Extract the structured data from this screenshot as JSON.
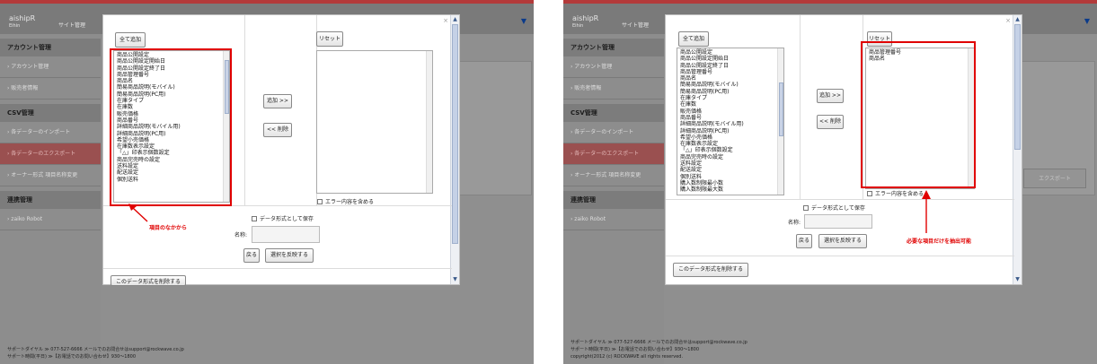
{
  "app": {
    "logo": "aishipR",
    "logo_sub": "Eihin",
    "site_manager": "サイト管理",
    "menu_arrow_icon": "triangle-down-icon"
  },
  "sidebar": {
    "account_section": "アカウント管理",
    "account_mgmt": "› アカウント管理",
    "seller_info": "› 販売者情報",
    "csv_section": "CSV管理",
    "import": "› 各データーのインポート",
    "export": "› 各データーのエクスポート",
    "owner_format": "› オーナー形式 項目名称変更",
    "integration_section": "連携管理",
    "zaiko": "› zaiko Robot"
  },
  "main": {
    "export_button": "エクスポート"
  },
  "footer": {
    "line1": "サポートダイヤル ≫ 077-527-6666 メールでのお問合せはsupport@rockwave.co.jp",
    "line2": "サポート時間(平日) ≫【お電話でのお問い合わせ】930～1800",
    "line3": "copyright(2012 (c) ROCKWAVE all rights reserved."
  },
  "modal": {
    "close_icon": "close-icon",
    "add_all": "全て追加",
    "reset": "リセット",
    "add_button": "追加 >>",
    "remove_button": "<< 削除",
    "error_checkbox": "エラー内容を含める",
    "save_format_checkbox": "データ形式として保存",
    "name_label": "名称:",
    "back_button": "戻る",
    "apply_button": "選択を反映する",
    "delete_format_button": "このデータ形式を削除する",
    "available_items": [
      "商品公開設定",
      "商品公開設定開始日",
      "商品公開設定終了日",
      "商品管理番号",
      "商品名",
      "簡易商品説明(モバイル)",
      "簡易商品説明(PC用)",
      "在庫タイプ",
      "在庫数",
      "販売価格",
      "商品番号",
      "詳細商品説明(モバイル用)",
      "詳細商品説明(PC用)",
      "希望小売価格",
      "在庫数表示設定",
      "「△」印表示個数設定",
      "商品完売時の設定",
      "送料設定",
      "配送設定",
      "個別送料",
      "購入数制限最小数",
      "購入数制限最大数"
    ],
    "selected_items": [
      "商品管理番号",
      "商品名"
    ]
  },
  "annotations": {
    "left": "項目のなかから",
    "right": "必要な項目だけを抽出可能",
    "color": "#e00000"
  },
  "colors": {
    "brand_bar": "#b33a3a",
    "active_menu": "#9a5050"
  }
}
